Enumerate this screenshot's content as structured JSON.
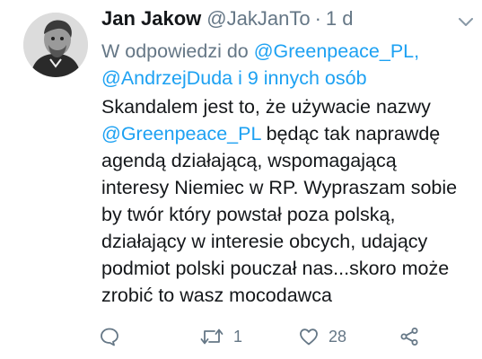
{
  "tweet": {
    "author": {
      "name": "Jan Jakow",
      "handle": "@JakJanTo",
      "time": "1 d",
      "separator": "·"
    },
    "reply_to": {
      "prefix": "W odpowiedzi do",
      "mention_1": "@Greenpeace_PL,",
      "mention_2": "@AndrzejDuda i 9 innych osób"
    },
    "text": {
      "line_1": "Skandalem jest to, że używacie nazwy",
      "mention": "@Greenpeace_PL",
      "line_2_rest": " będąc tak naprawdę",
      "line_3": "agendą działającą, wspomagającą",
      "line_4": "interesy Niemiec w RP. Wypraszam sobie",
      "line_5": "by twór który powstał poza polską,",
      "line_6": "działający w interesie obcych, udający",
      "line_7": "podmiot polski pouczał nas...skoro może",
      "line_8": "zrobić to wasz mocodawca"
    },
    "actions": {
      "reply": {
        "icon": "comment-icon",
        "count": ""
      },
      "retweet": {
        "icon": "retweet-icon",
        "count": "1"
      },
      "like": {
        "icon": "heart-icon",
        "count": "28"
      },
      "share": {
        "icon": "share-icon"
      }
    }
  },
  "colors": {
    "text": "#14171a",
    "secondary": "#657786",
    "link": "#1da1f2",
    "icon": "#657786"
  }
}
